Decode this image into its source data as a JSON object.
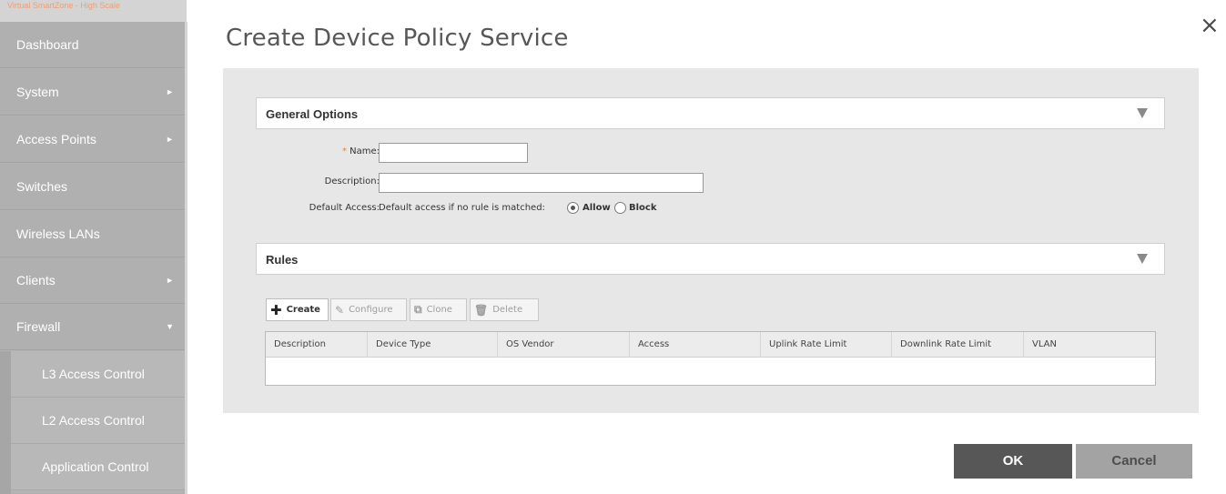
{
  "brand": {
    "text": "Virtual SmartZone - High Scale"
  },
  "sidebar": {
    "items": [
      {
        "label": "Dashboard",
        "arrow": ""
      },
      {
        "label": "System",
        "arrow": "►"
      },
      {
        "label": "Access Points",
        "arrow": "►"
      },
      {
        "label": "Switches",
        "arrow": ""
      },
      {
        "label": "Wireless LANs",
        "arrow": ""
      },
      {
        "label": "Clients",
        "arrow": "►"
      },
      {
        "label": "Firewall",
        "arrow": "▼"
      }
    ],
    "subitems": [
      {
        "label": "L3 Access Control"
      },
      {
        "label": "L2 Access Control"
      },
      {
        "label": "Application Control"
      }
    ]
  },
  "dialog": {
    "title": "Create Device Policy Service",
    "close_glyph": "×"
  },
  "general": {
    "section_title": "General Options",
    "name_required_mark": "*",
    "name_label": "Name:",
    "name_value": "",
    "description_label": "Description:",
    "description_value": "",
    "default_access_label": "Default Access:",
    "default_access_text": "Default access if no rule is matched:",
    "allow_label": "Allow",
    "block_label": "Block",
    "selected": "Allow"
  },
  "rules": {
    "section_title": "Rules",
    "toolbar": {
      "create_label": "Create",
      "configure_label": "Configure",
      "clone_label": "Clone",
      "delete_label": "Delete"
    },
    "columns": [
      "Description",
      "Device Type",
      "OS Vendor",
      "Access",
      "Uplink Rate Limit",
      "Downlink Rate Limit",
      "VLAN"
    ],
    "rows": []
  },
  "footer": {
    "ok_label": "OK",
    "cancel_label": "Cancel"
  },
  "colors": {
    "sidebar_bg": "#b3b3b3",
    "panel_bg": "#e7e7e7",
    "ok_bg": "#575757",
    "cancel_bg": "#a3a3a3",
    "required_mark": "#e8852b"
  },
  "icons": {
    "create": "plus-icon",
    "configure": "pencil-icon",
    "clone": "clone-icon",
    "delete": "trash-icon",
    "close": "close-icon",
    "section_toggle": "triangle-down-icon"
  }
}
